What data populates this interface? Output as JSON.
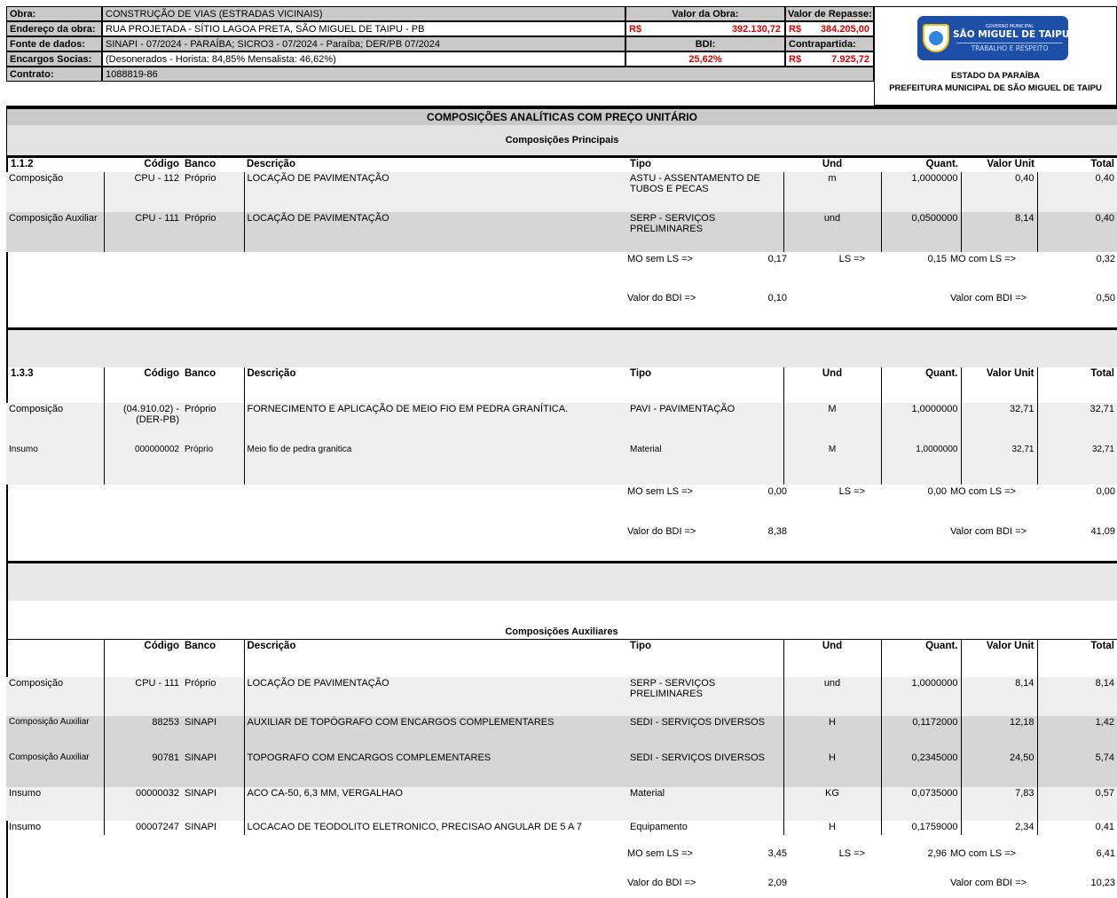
{
  "header": {
    "obra_label": "Obra:",
    "obra_value": "CONSTRUÇÃO DE VIAS (ESTRADAS VICINAIS)",
    "endereco_label": "Endereço da obra:",
    "endereco_value": "RUA PROJETADA - SÍTIO LAGOA PRETA, SÃO MIGUEL DE TAIPU - PB",
    "fonte_label": "Fonte de dados:",
    "fonte_value": "SINAPI - 07/2024 - PARAÍBA; SICRO3 - 07/2024 - Paraíba; DER/PB 07/2024",
    "encargos_label": "Encargos Socias:",
    "encargos_value": "(Desonerados - Horista: 84,85% Mensalista: 46,62%)",
    "contrato_label": "Contrato:",
    "contrato_value": "1088819-86",
    "valor_obra_label": "Valor da Obra:",
    "valor_obra_currency": "R$",
    "valor_obra_value": "392.130,72",
    "bdi_label": "BDI:",
    "bdi_value": "25,62%",
    "repasse_label": "Valor de Repasse:",
    "repasse_currency": "R$",
    "repasse_value": "384.205,00",
    "contrapartida_label": "Contrapartida:",
    "contrapartida_currency": "R$",
    "contrapartida_value": "7.925,72"
  },
  "logo": {
    "small_text": "GOVERNO MUNICIPAL",
    "name": "SÃO MIGUEL DE TAIPU",
    "slogan": "TRABALHO E RESPEITO",
    "state": "ESTADO DA PARAÍBA",
    "prefeitura": "PREFEITURA MUNICIPAL DE SÃO MIGUEL DE TAIPU"
  },
  "title": "COMPOSIÇÕES ANALÍTICAS COM PREÇO UNITÁRIO",
  "principais_title": "Composições Principais",
  "auxiliares_title": "Composições Auxiliares",
  "columns": {
    "codigo": "Código",
    "banco": "Banco",
    "descricao": "Descrição",
    "tipo": "Tipo",
    "und": "Und",
    "quant": "Quant.",
    "valor_unit": "Valor Unit",
    "total": "Total"
  },
  "summary_labels": {
    "mo_sem_ls": "MO sem LS =>",
    "ls": "LS =>",
    "mo_com_ls": "MO com LS =>",
    "valor_bdi": "Valor do BDI =>",
    "valor_com_bdi": "Valor com BDI =>"
  },
  "section1": {
    "item": "1.1.2",
    "rows": [
      {
        "type": "Composição",
        "codigo": "CPU - 112",
        "banco": "Próprio",
        "descricao": "LOCAÇÃO DE PAVIMENTAÇÃO",
        "tipo": "ASTU - ASSENTAMENTO DE TUBOS E PECAS",
        "und": "m",
        "quant": "1,0000000",
        "valor_unit": "0,40",
        "total": "0,40"
      },
      {
        "type": "Composição Auxiliar",
        "codigo": "CPU - 111",
        "banco": "Próprio",
        "descricao": "LOCAÇÃO DE PAVIMENTAÇÃO",
        "tipo": "SERP - SERVIÇOS PRELIMINARES",
        "und": "und",
        "quant": "0,0500000",
        "valor_unit": "8,14",
        "total": "0,40"
      }
    ],
    "mo_sem_ls": "0,17",
    "ls": "0,15",
    "mo_com_ls": "0,32",
    "valor_bdi": "0,10",
    "valor_com_bdi": "0,50"
  },
  "section2": {
    "item": "1.3.3",
    "rows": [
      {
        "type": "Composição",
        "codigo": "(04.910.02) - (DER-PB)",
        "banco": "Próprio",
        "descricao": "FORNECIMENTO E APLICAÇÃO DE MEIO FIO EM PEDRA GRANÍTICA.",
        "tipo": "PAVI - PAVIMENTAÇÃO",
        "und": "M",
        "quant": "1,0000000",
        "valor_unit": "32,71",
        "total": "32,71"
      },
      {
        "type": "Insumo",
        "codigo": "000000002",
        "banco": "Próprio",
        "descricao": "Meio fio de pedra granitica",
        "tipo": "Material",
        "und": "M",
        "quant": "1,0000000",
        "valor_unit": "32,71",
        "total": "32,71"
      }
    ],
    "mo_sem_ls": "0,00",
    "ls": "0,00",
    "mo_com_ls": "0,00",
    "valor_bdi": "8,38",
    "valor_com_bdi": "41,09"
  },
  "section3": {
    "rows": [
      {
        "type": "Composição",
        "codigo": "CPU - 111",
        "banco": "Próprio",
        "descricao": "LOCAÇÃO DE PAVIMENTAÇÃO",
        "tipo": "SERP - SERVIÇOS PRELIMINARES",
        "und": "und",
        "quant": "1,0000000",
        "valor_unit": "8,14",
        "total": "8,14"
      },
      {
        "type": "Composição Auxiliar",
        "codigo": "88253",
        "banco": "SINAPI",
        "descricao": "AUXILIAR DE TOPÓGRAFO COM ENCARGOS COMPLEMENTARES",
        "tipo": "SEDI - SERVIÇOS DIVERSOS",
        "und": "H",
        "quant": "0,1172000",
        "valor_unit": "12,18",
        "total": "1,42"
      },
      {
        "type": "Composição Auxiliar",
        "codigo": "90781",
        "banco": "SINAPI",
        "descricao": "TOPOGRAFO COM ENCARGOS COMPLEMENTARES",
        "tipo": "SEDI - SERVIÇOS DIVERSOS",
        "und": "H",
        "quant": "0,2345000",
        "valor_unit": "24,50",
        "total": "5,74"
      },
      {
        "type": "Insumo",
        "codigo": "00000032",
        "banco": "SINAPI",
        "descricao": "ACO CA-50, 6,3 MM, VERGALHAO",
        "tipo": "Material",
        "und": "KG",
        "quant": "0,0735000",
        "valor_unit": "7,83",
        "total": "0,57"
      },
      {
        "type": "Insumo",
        "codigo": "00007247",
        "banco": "SINAPI",
        "descricao": "LOCACAO DE TEODOLITO ELETRONICO, PRECISAO ANGULAR DE 5 A 7",
        "tipo": "Equipamento",
        "und": "H",
        "quant": "0,1759000",
        "valor_unit": "2,34",
        "total": "0,41"
      }
    ],
    "mo_sem_ls": "3,45",
    "ls": "2,96",
    "mo_com_ls": "6,41",
    "valor_bdi": "2,09",
    "valor_com_bdi": "10,23"
  }
}
